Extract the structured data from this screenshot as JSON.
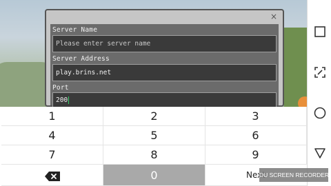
{
  "dialog": {
    "close_symbol": "×",
    "server_name": {
      "label": "Server Name",
      "placeholder": "Please enter server name"
    },
    "server_address": {
      "label": "Server Address",
      "value": "play.brins.net"
    },
    "port": {
      "label": "Port",
      "value": "200"
    }
  },
  "keypad": {
    "keys": [
      "1",
      "2",
      "3",
      "4",
      "5",
      "6",
      "7",
      "8",
      "9"
    ],
    "zero": "0",
    "next": "Next",
    "backspace_icon": "backspace-icon"
  },
  "navbar": {
    "icons": [
      "recents-square-icon",
      "screenshot-crop-icon",
      "home-circle-icon",
      "back-triangle-icon"
    ]
  },
  "watermark": "DU SCREEN RECORDER",
  "colors": {
    "dialog_bg": "#c6c6c6",
    "dialog_inner": "#6b6b6b",
    "field_bg": "#3a3a3a",
    "caret": "#33cc66",
    "zero_key": "#a9a9a9"
  }
}
